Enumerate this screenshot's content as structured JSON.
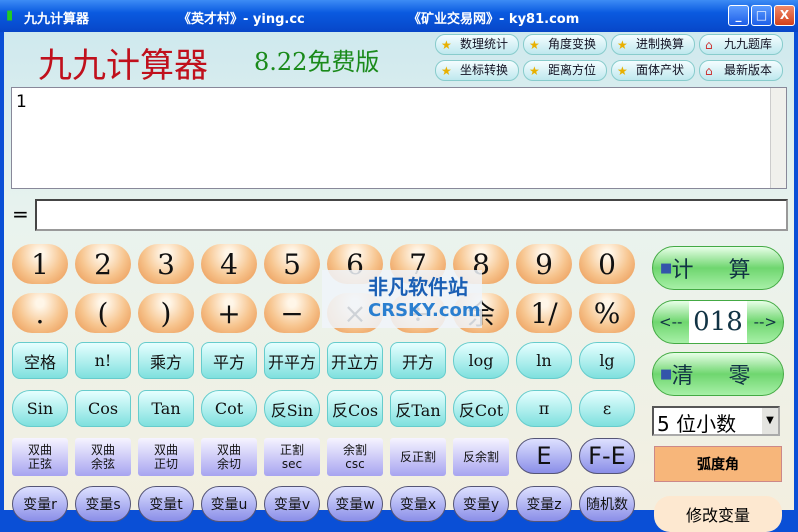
{
  "window": {
    "title": "九九计算器",
    "link1": "《英才村》- ying.cc",
    "link2": "《矿业交易网》- ky81.com",
    "min": "_",
    "max": "□",
    "close": "X"
  },
  "header": {
    "title": "九九计算器",
    "version": "8.22免费版"
  },
  "toolbar": [
    "数理统计",
    "角度变换",
    "进制换算",
    "九九题库",
    "坐标转换",
    "距离方位",
    "面体产状",
    "最新版本"
  ],
  "display": {
    "input": "1",
    "equals": "=",
    "result": ""
  },
  "rows": [
    {
      "cls": "num",
      "keys": [
        "1",
        "2",
        "3",
        "4",
        "5",
        "6",
        "7",
        "8",
        "9",
        "0"
      ]
    },
    {
      "cls": "num",
      "keys": [
        ".",
        "(",
        ")",
        "+",
        "−",
        "×",
        "÷",
        "余",
        "1/",
        "%"
      ]
    },
    {
      "cls": "fn",
      "keys": [
        "空格",
        "n!",
        "乘方",
        "平方",
        "开平方",
        "开立方",
        "开方",
        "log",
        "ln",
        "lg"
      ]
    },
    {
      "cls": "fn",
      "keys": [
        "Sin",
        "Cos",
        "Tan",
        "Cot",
        "反Sin",
        "反Cos",
        "反Tan",
        "反Cot",
        "π",
        "ε"
      ]
    },
    {
      "cls": "hy",
      "keys": [
        "双曲\n正弦",
        "双曲\n余弦",
        "双曲\n正切",
        "双曲\n余切",
        "正割\nsec",
        "余割\ncsc",
        "反正割",
        "反余割",
        "E",
        "F-E"
      ]
    },
    {
      "cls": "var",
      "keys": [
        "变量r",
        "变量s",
        "变量t",
        "变量u",
        "变量v",
        "变量w",
        "变量x",
        "变量y",
        "变量z",
        "随机数"
      ]
    }
  ],
  "side": {
    "calc": "计 算",
    "prev": "<--",
    "counter": "018",
    "next": "-->",
    "clear": "清 零",
    "decimals": "5 位小数",
    "angle": "弧度角",
    "modify": "修改变量"
  },
  "watermark": {
    "line1": "非凡软件站",
    "line2": "CRSKY.com"
  }
}
